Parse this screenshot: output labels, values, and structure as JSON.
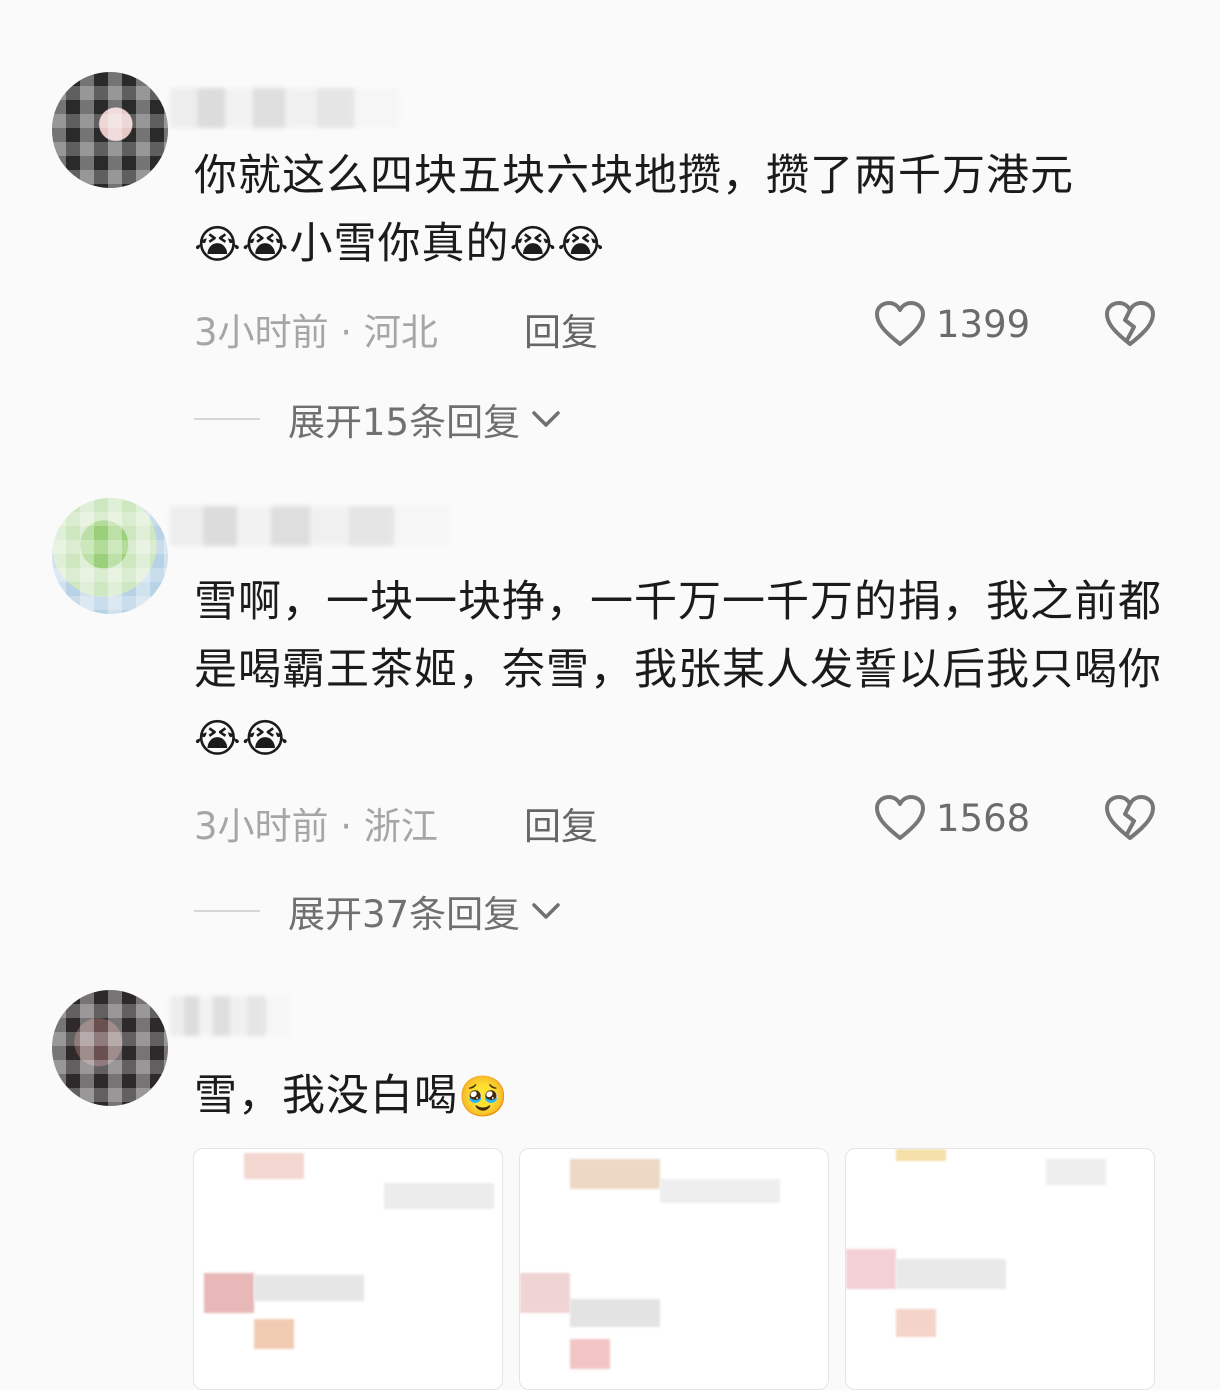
{
  "comments": [
    {
      "text": "你就这么四块五块六块地攒，攒了两千万港元",
      "text_line2": "小雪你真的",
      "emoji": "😭",
      "time_location": "3小时前 · 河北",
      "reply_label": "回复",
      "likes": "1399",
      "expand_label": "展开15条回复"
    },
    {
      "text": "雪啊，一块一块挣，一千万一千万的捐，我之前都是喝霸王茶姬，奈雪，我张某人发誓以后我只喝你",
      "emoji": "😭",
      "time_location": "3小时前 · 浙江",
      "reply_label": "回复",
      "likes": "1568",
      "expand_label": "展开37条回复"
    },
    {
      "text": "雪，我没白喝",
      "emoji": "🥹"
    }
  ],
  "icons": {
    "like": "heart-outline-icon",
    "dislike": "broken-heart-icon",
    "expand": "chevron-down-icon"
  }
}
